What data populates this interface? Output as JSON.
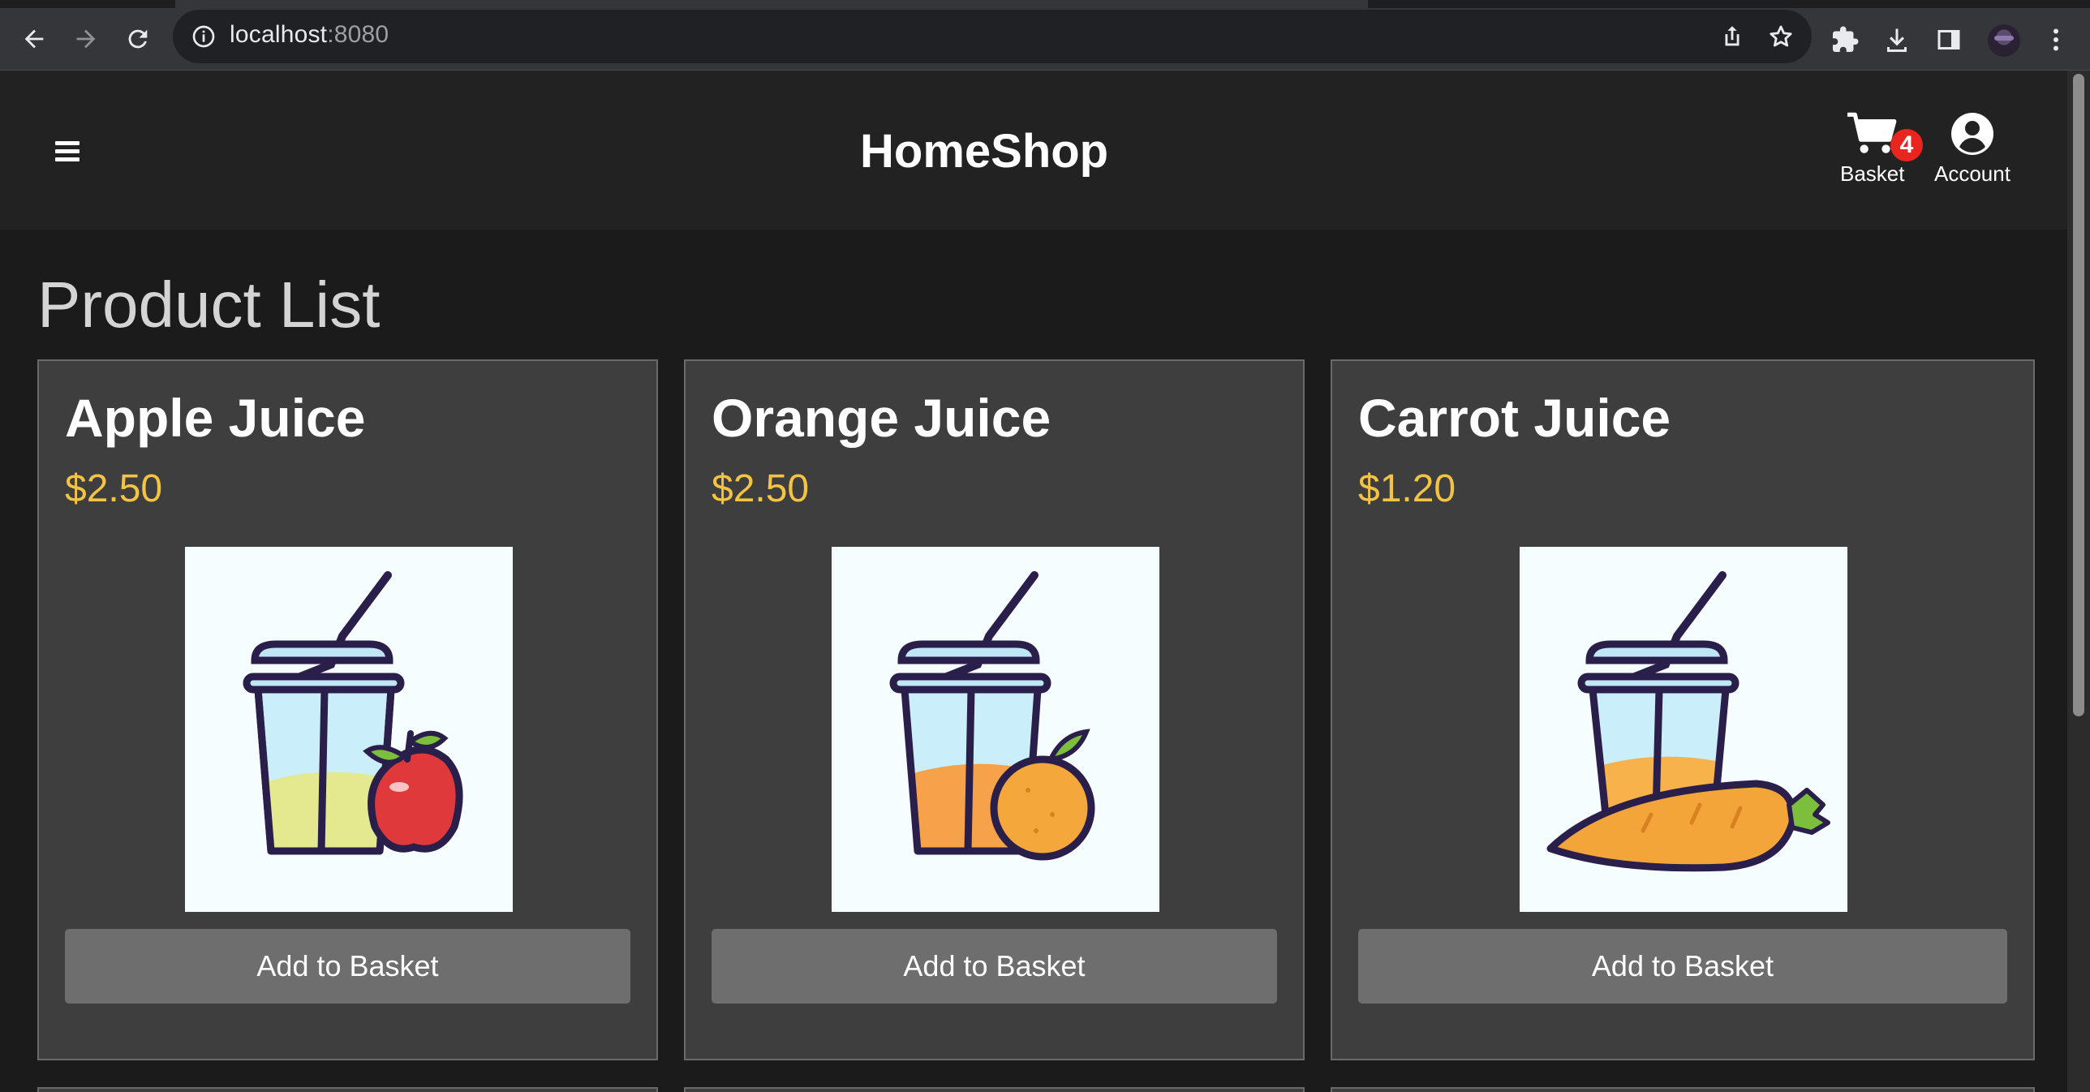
{
  "browser": {
    "url_host": "localhost",
    "url_port": ":8080"
  },
  "header": {
    "brand": "HomeShop",
    "basket_label": "Basket",
    "basket_count": "4",
    "account_label": "Account"
  },
  "page": {
    "title": "Product List"
  },
  "products": [
    {
      "name": "Apple Juice",
      "price": "$2.50",
      "button": "Add to Basket",
      "fruit": "apple",
      "juice_color": "#e4e98f"
    },
    {
      "name": "Orange Juice",
      "price": "$2.50",
      "button": "Add to Basket",
      "fruit": "orange",
      "juice_color": "#f5a24a"
    },
    {
      "name": "Carrot Juice",
      "price": "$1.20",
      "button": "Add to Basket",
      "fruit": "carrot",
      "juice_color": "#f7b24b"
    }
  ],
  "colors": {
    "price": "#f3c343",
    "badge": "#e8261f",
    "card_bg": "#3e3e3f",
    "button_bg": "#6e6e6f"
  }
}
